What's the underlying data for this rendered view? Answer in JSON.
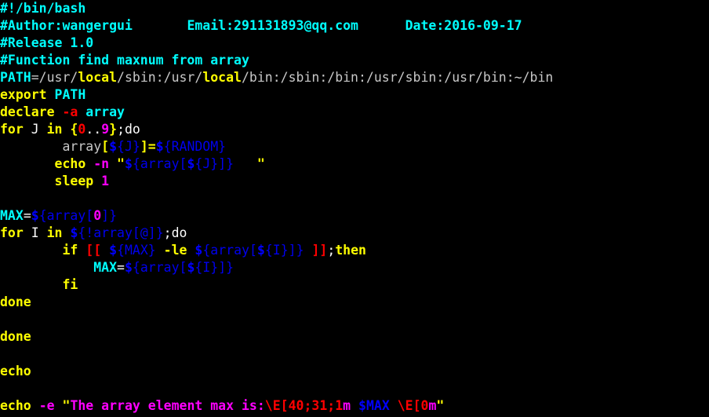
{
  "app": {
    "title": "bash script editor",
    "background": "#000000",
    "font_size_px": 16.5,
    "line_height_px": 22
  },
  "palette": {
    "cyan": "#00cdcd",
    "cyan_bold": "#00ffff",
    "white": "#c8c8c8",
    "yellow": "#e5e500",
    "yellow_bold": "#ffff00",
    "red": "#cd0000",
    "magenta": "#cd00cd",
    "magenta_bold": "#ff00ff",
    "blue": "#0000ee",
    "blue_bold": "#0000ff",
    "blue_light": "#4466ff"
  },
  "script": {
    "name": "find maxnum from array",
    "author": "wangergui",
    "email": "291131893@qq.com",
    "date": "2016-09-17",
    "release": "1.0",
    "plain_text": "#!/bin/bash\n#Author:wangergui       Email:291131893@qq.com      Date:2016-09-17\n#Release 1.0\n#Function find maxnum from array\nPATH=/usr/local/sbin:/usr/local/bin:/sbin:/bin:/usr/sbin:/usr/bin:~/bin\nexport PATH\ndeclare -a array\nfor J in {0..9};do\n        array[${J}]=${RANDOM}\n       echo -n \"${array[${J}]}   \"\n       sleep 1\n\nMAX=${array[0]}\nfor I in ${!array[@]};do\n        if [[ ${MAX} -le ${array[${I}]} ]];then\n            MAX=${array[${I}]}\n        fi\ndone\n\ndone\n\necho\n\necho -e \"The array element max is:\\E[40;31;1m $MAX \\E[0m\""
  },
  "lines": [
    {
      "n": 1,
      "tokens": [
        {
          "t": "#!/bin/bash",
          "c": "c-cyanb"
        }
      ]
    },
    {
      "n": 2,
      "tokens": [
        {
          "t": "#Author:wangergui",
          "c": "c-cyanb"
        },
        {
          "t": "       ",
          "c": "c-white"
        },
        {
          "t": "Email:291131893@qq.com",
          "c": "c-cyanb"
        },
        {
          "t": "      ",
          "c": "c-white"
        },
        {
          "t": "Date:2016-09-17",
          "c": "c-cyanb"
        }
      ]
    },
    {
      "n": 3,
      "tokens": [
        {
          "t": "#Release 1.0",
          "c": "c-cyanb"
        }
      ]
    },
    {
      "n": 4,
      "tokens": [
        {
          "t": "#Function find maxnum from array",
          "c": "c-cyanb"
        }
      ]
    },
    {
      "n": 5,
      "tokens": [
        {
          "t": "PATH",
          "c": "c-cyanb"
        },
        {
          "t": "=/usr/",
          "c": "c-white"
        },
        {
          "t": "local",
          "c": "c-yellowb"
        },
        {
          "t": "/sbin:/usr/",
          "c": "c-white"
        },
        {
          "t": "local",
          "c": "c-yellowb"
        },
        {
          "t": "/bin:/sbin:/bin:/usr/sbin:/usr/bin:~/bin",
          "c": "c-white"
        }
      ]
    },
    {
      "n": 6,
      "tokens": [
        {
          "t": "export",
          "c": "c-yellowb"
        },
        {
          "t": " ",
          "c": "c-white"
        },
        {
          "t": "PATH",
          "c": "c-cyanb"
        }
      ]
    },
    {
      "n": 7,
      "tokens": [
        {
          "t": "declare",
          "c": "c-yellowb"
        },
        {
          "t": " ",
          "c": "c-white"
        },
        {
          "t": "-a",
          "c": "c-redb"
        },
        {
          "t": " ",
          "c": "c-white"
        },
        {
          "t": "array",
          "c": "c-cyanb"
        }
      ]
    },
    {
      "n": 8,
      "tokens": [
        {
          "t": "for",
          "c": "c-yellowb"
        },
        {
          "t": " J ",
          "c": "c-whiteb"
        },
        {
          "t": "in",
          "c": "c-yellowb"
        },
        {
          "t": " ",
          "c": "c-whiteb"
        },
        {
          "t": "{",
          "c": "c-yellowb"
        },
        {
          "t": "0",
          "c": "c-redb"
        },
        {
          "t": "..",
          "c": "c-whiteb"
        },
        {
          "t": "9",
          "c": "c-magentab"
        },
        {
          "t": "}",
          "c": "c-yellowb"
        },
        {
          "t": ";do",
          "c": "c-whiteb"
        }
      ]
    },
    {
      "n": 9,
      "tokens": [
        {
          "t": "        array",
          "c": "c-white"
        },
        {
          "t": "[",
          "c": "c-yellowb"
        },
        {
          "t": "$",
          "c": "c-blueb"
        },
        {
          "t": "{J}",
          "c": "c-blue"
        },
        {
          "t": "]",
          "c": "c-yellowb"
        },
        {
          "t": "=",
          "c": "c-yellowb"
        },
        {
          "t": "$",
          "c": "c-blueb"
        },
        {
          "t": "{RANDOM}",
          "c": "c-blue"
        }
      ]
    },
    {
      "n": 10,
      "tokens": [
        {
          "t": "       ",
          "c": "c-white"
        },
        {
          "t": "echo",
          "c": "c-yellowb"
        },
        {
          "t": " ",
          "c": "c-white"
        },
        {
          "t": "-n",
          "c": "c-magentab"
        },
        {
          "t": " ",
          "c": "c-white"
        },
        {
          "t": "\"",
          "c": "c-yellowb"
        },
        {
          "t": "$",
          "c": "c-blueb"
        },
        {
          "t": "{array[",
          "c": "c-blue"
        },
        {
          "t": "$",
          "c": "c-blueb"
        },
        {
          "t": "{J}]}",
          "c": "c-blue"
        },
        {
          "t": "   ",
          "c": "c-white"
        },
        {
          "t": "\"",
          "c": "c-yellowb"
        }
      ]
    },
    {
      "n": 11,
      "tokens": [
        {
          "t": "       ",
          "c": "c-white"
        },
        {
          "t": "sleep",
          "c": "c-yellowb"
        },
        {
          "t": " ",
          "c": "c-white"
        },
        {
          "t": "1",
          "c": "c-magentab"
        }
      ]
    },
    {
      "n": 12,
      "tokens": []
    },
    {
      "n": 13,
      "tokens": [
        {
          "t": "MAX",
          "c": "c-cyanb"
        },
        {
          "t": "=",
          "c": "c-whiteb"
        },
        {
          "t": "$",
          "c": "c-blueb"
        },
        {
          "t": "{array[",
          "c": "c-blue"
        },
        {
          "t": "0",
          "c": "c-magentab"
        },
        {
          "t": "]}",
          "c": "c-blue"
        }
      ]
    },
    {
      "n": 14,
      "tokens": [
        {
          "t": "for",
          "c": "c-yellowb"
        },
        {
          "t": " I ",
          "c": "c-whiteb"
        },
        {
          "t": "in",
          "c": "c-yellowb"
        },
        {
          "t": " ",
          "c": "c-whiteb"
        },
        {
          "t": "$",
          "c": "c-blueb"
        },
        {
          "t": "{!array[@]}",
          "c": "c-blue"
        },
        {
          "t": ";do",
          "c": "c-whiteb"
        }
      ]
    },
    {
      "n": 15,
      "tokens": [
        {
          "t": "        ",
          "c": "c-white"
        },
        {
          "t": "if",
          "c": "c-yellowb"
        },
        {
          "t": " ",
          "c": "c-white"
        },
        {
          "t": "[[",
          "c": "c-redb"
        },
        {
          "t": " ",
          "c": "c-white"
        },
        {
          "t": "$",
          "c": "c-blueb"
        },
        {
          "t": "{MAX}",
          "c": "c-blue"
        },
        {
          "t": " ",
          "c": "c-white"
        },
        {
          "t": "-le",
          "c": "c-yellowb"
        },
        {
          "t": " ",
          "c": "c-white"
        },
        {
          "t": "$",
          "c": "c-blueb"
        },
        {
          "t": "{array[",
          "c": "c-blue"
        },
        {
          "t": "$",
          "c": "c-blueb"
        },
        {
          "t": "{I}]}",
          "c": "c-blue"
        },
        {
          "t": " ",
          "c": "c-white"
        },
        {
          "t": "]]",
          "c": "c-redb"
        },
        {
          "t": ";",
          "c": "c-whiteb"
        },
        {
          "t": "then",
          "c": "c-yellowb"
        }
      ]
    },
    {
      "n": 16,
      "tokens": [
        {
          "t": "            ",
          "c": "c-white"
        },
        {
          "t": "MAX",
          "c": "c-cyanb"
        },
        {
          "t": "=",
          "c": "c-whiteb"
        },
        {
          "t": "$",
          "c": "c-blueb"
        },
        {
          "t": "{array[",
          "c": "c-blue"
        },
        {
          "t": "$",
          "c": "c-blueb"
        },
        {
          "t": "{I}]}",
          "c": "c-blue"
        }
      ]
    },
    {
      "n": 17,
      "tokens": [
        {
          "t": "        ",
          "c": "c-white"
        },
        {
          "t": "fi",
          "c": "c-yellowb"
        }
      ]
    },
    {
      "n": 18,
      "tokens": [
        {
          "t": "done",
          "c": "c-yellowb"
        }
      ]
    },
    {
      "n": 19,
      "tokens": []
    },
    {
      "n": 20,
      "tokens": [
        {
          "t": "done",
          "c": "c-yellowb"
        }
      ]
    },
    {
      "n": 21,
      "tokens": []
    },
    {
      "n": 22,
      "tokens": [
        {
          "t": "echo",
          "c": "c-yellowb"
        }
      ]
    },
    {
      "n": 23,
      "tokens": []
    },
    {
      "n": 24,
      "tokens": [
        {
          "t": "echo",
          "c": "c-yellowb"
        },
        {
          "t": " ",
          "c": "c-white"
        },
        {
          "t": "-e",
          "c": "c-magentab"
        },
        {
          "t": " ",
          "c": "c-white"
        },
        {
          "t": "\"",
          "c": "c-yellowb"
        },
        {
          "t": "The array element max is:",
          "c": "c-magentab"
        },
        {
          "t": "\\E[40;31;1",
          "c": "c-redb"
        },
        {
          "t": "m",
          "c": "c-magentab"
        },
        {
          "t": " ",
          "c": "c-white"
        },
        {
          "t": "$MAX",
          "c": "c-blueb"
        },
        {
          "t": " ",
          "c": "c-white"
        },
        {
          "t": "\\E[0",
          "c": "c-redb"
        },
        {
          "t": "m",
          "c": "c-magentab"
        },
        {
          "t": "\"",
          "c": "c-yellowb"
        }
      ]
    }
  ]
}
